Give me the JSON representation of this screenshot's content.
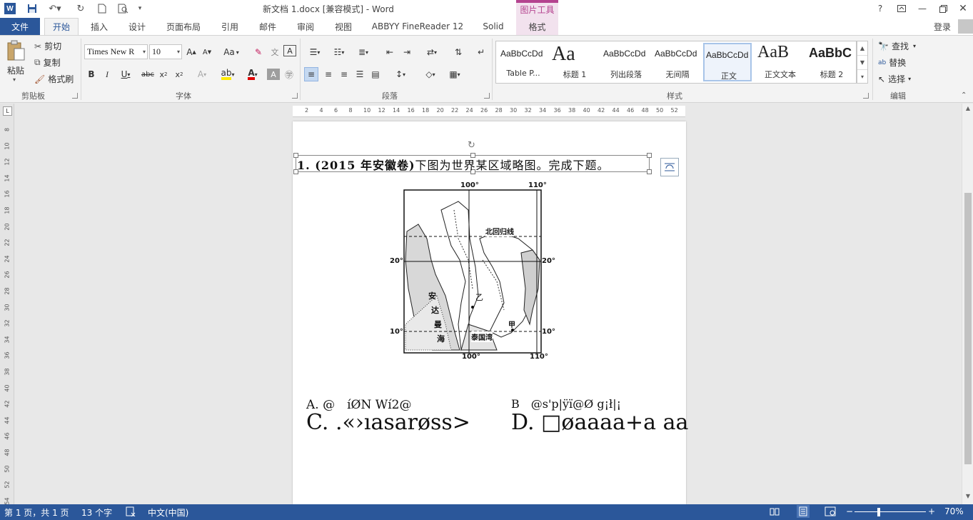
{
  "app": {
    "title": "新文档 1.docx [兼容模式] - Word",
    "context_tab_group": "图片工具",
    "login": "登录",
    "help": "?"
  },
  "tabs": [
    "文件",
    "开始",
    "插入",
    "设计",
    "页面布局",
    "引用",
    "邮件",
    "审阅",
    "视图",
    "ABBYY FineReader 12",
    "Solid",
    "格式"
  ],
  "ribbon": {
    "clipboard": {
      "label": "剪贴板",
      "paste": "粘贴",
      "cut": "剪切",
      "copy": "复制",
      "format_painter": "格式刷"
    },
    "font": {
      "label": "字体",
      "font_name": "Times New R",
      "font_size": "10",
      "case": "Aa"
    },
    "paragraph": {
      "label": "段落"
    },
    "styles": {
      "label": "样式",
      "items": [
        {
          "sample": "AaBbCcDd",
          "name": "Table P..."
        },
        {
          "sample": "Aa",
          "name": "标题 1"
        },
        {
          "sample": "AaBbCcDd",
          "name": "列出段落"
        },
        {
          "sample": "AaBbCcDd",
          "name": "无间隔"
        },
        {
          "sample": "AaBbCcDd",
          "name": "正文"
        },
        {
          "sample": "AaB",
          "name": "正文文本"
        },
        {
          "sample": "AaBbC",
          "name": "标题 2"
        }
      ]
    },
    "editing": {
      "label": "编辑",
      "find": "查找",
      "replace": "替换",
      "select": "选择"
    }
  },
  "ruler": {
    "horizontal": [
      "2",
      "4",
      "6",
      "8",
      "10",
      "12",
      "14",
      "16",
      "18",
      "20",
      "22",
      "24",
      "26",
      "28",
      "30",
      "32",
      "34",
      "36",
      "38",
      "40",
      "42",
      "44",
      "46",
      "48",
      "50",
      "52"
    ],
    "vertical": [
      "8",
      "10",
      "12",
      "14",
      "16",
      "18",
      "20",
      "22",
      "24",
      "26",
      "28",
      "30",
      "32",
      "34",
      "36",
      "38",
      "40",
      "42",
      "44",
      "46",
      "48",
      "50",
      "52",
      "54"
    ]
  },
  "document": {
    "question_prefix": "1. (2015 年安徽卷)",
    "question_text": "下图为世界某区域略图。完成下题。",
    "map": {
      "lon_100": "100°",
      "lon_110": "110°",
      "lat_20": "20°",
      "lat_10": "10°",
      "tropic": "北回归线",
      "sea": [
        "安",
        "达",
        "曼",
        "海"
      ],
      "gulf": "泰国湾",
      "point_yi": "乙",
      "point_jia": "甲"
    },
    "option_a": "A. @　íØN Wí2@",
    "option_b": "B　@s'p|ÿï@Ø g¡ł|¡",
    "option_c": "C. .«›ıasarøss>",
    "option_d": "D. □øaaaa+a aa"
  },
  "status": {
    "page": "第 1 页，共 1 页",
    "words": "13 个字",
    "language": "中文(中国)",
    "zoom": "70%"
  }
}
